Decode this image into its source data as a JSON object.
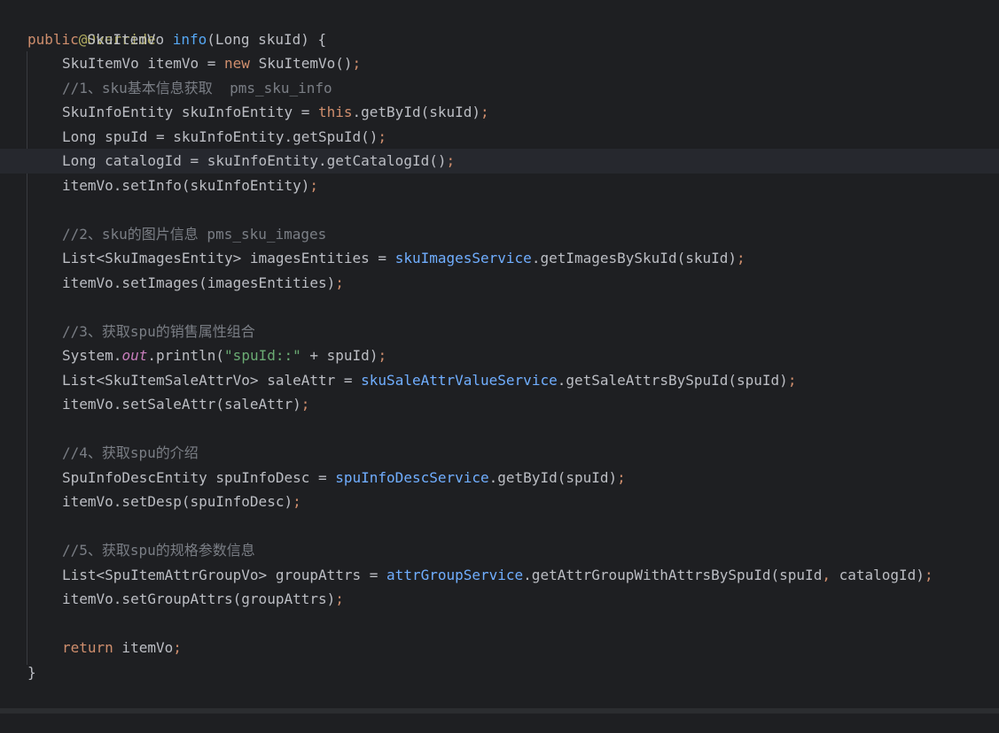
{
  "editor": {
    "lines": [
      {
        "ann": "@Override"
      },
      {
        "kw": "public",
        "t1": " SkuItemVo ",
        "fn": "info",
        "t2": "(Long skuId) {"
      },
      {
        "t1": "SkuItemVo itemVo = ",
        "kw": "new",
        "t2": " SkuItemVo()",
        "semi": ";"
      },
      {
        "cmt": "//1、sku基本信息获取  pms_sku_info"
      },
      {
        "t1": "SkuInfoEntity skuInfoEntity = ",
        "kw": "this",
        "t2": ".getById(skuId)",
        "semi": ";"
      },
      {
        "t1": "Long spuId = skuInfoEntity.getSpuId()",
        "semi": ";"
      },
      {
        "t1": "Long catalogId = skuInfoEntity.getCatalogId()",
        "semi": ";"
      },
      {
        "t1": "itemVo.setInfo(skuInfoEntity)",
        "semi": ";"
      },
      {
        "cmt": "//2、sku的图片信息 pms_sku_images"
      },
      {
        "t1": "List<SkuImagesEntity> imagesEntities = ",
        "svc": "skuImagesService",
        "t2": ".getImagesBySkuId(skuId)",
        "semi": ";"
      },
      {
        "t1": "itemVo.setImages(imagesEntities)",
        "semi": ";"
      },
      {
        "cmt": "//3、获取spu的销售属性组合"
      },
      {
        "t1": "System.",
        "stat": "out",
        "t2": ".println(",
        "str": "\"spuId::\"",
        "t3": " + spuId)",
        "semi": ";"
      },
      {
        "t1": "List<SkuItemSaleAttrVo> saleAttr = ",
        "svc": "skuSaleAttrValueService",
        "t2": ".getSaleAttrsBySpuId(spuId)",
        "semi": ";"
      },
      {
        "t1": "itemVo.setSaleAttr(saleAttr)",
        "semi": ";"
      },
      {
        "cmt": "//4、获取spu的介绍"
      },
      {
        "t1": "SpuInfoDescEntity spuInfoDesc = ",
        "svc": "spuInfoDescService",
        "t2": ".getById(spuId)",
        "semi": ";"
      },
      {
        "t1": "itemVo.setDesp(spuInfoDesc)",
        "semi": ";"
      },
      {
        "cmt": "//5、获取spu的规格参数信息"
      },
      {
        "t1": "List<SpuItemAttrGroupVo> groupAttrs = ",
        "svc": "attrGroupService",
        "t2": ".getAttrGroupWithAttrsBySpuId(spuId",
        "comma": ",",
        "t3": " catalogId)",
        "semi": ";"
      },
      {
        "t1": "itemVo.setGroupAttrs(groupAttrs)",
        "semi": ";"
      },
      {
        "kw": "return",
        "t1": " itemVo",
        "semi": ";"
      },
      {
        "t1": "}"
      }
    ]
  },
  "colors": {
    "background": "#1e1f22",
    "current_line": "#26282e",
    "text": "#bcbec4",
    "annotation": "#b3ae60",
    "keyword": "#cf8e6d",
    "method_decl": "#56a8f5",
    "service_field": "#70aeff",
    "static_field": "#c77dbb",
    "string": "#6aab73",
    "comment": "#7a7e85"
  }
}
